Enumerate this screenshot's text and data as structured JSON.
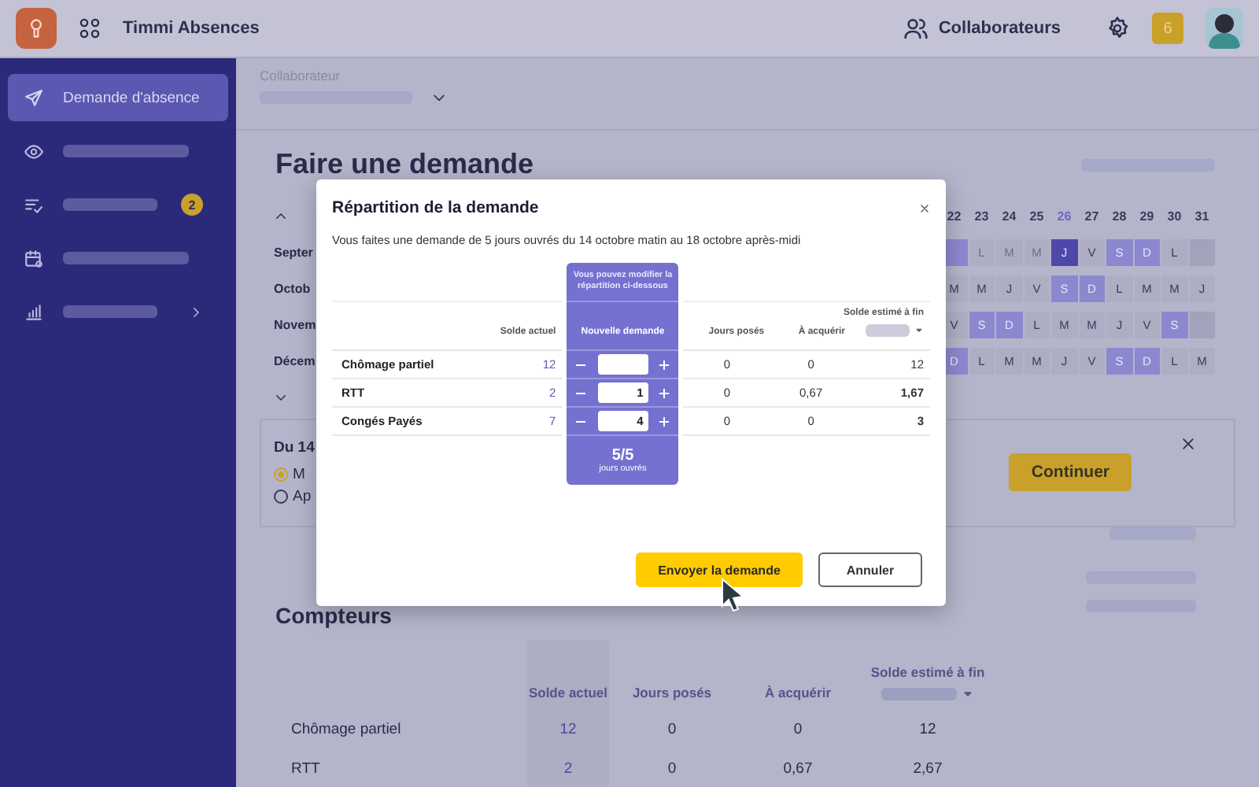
{
  "topbar": {
    "app_name": "Timmi Absences",
    "nav_link": "Collaborateurs",
    "notification_count": "6"
  },
  "sidebar": {
    "items": [
      {
        "label": "Demande d'absence",
        "selected": true,
        "expandable": false
      },
      {
        "selected": false,
        "expandable": false
      },
      {
        "selected": false,
        "expandable": false,
        "badge": "2"
      },
      {
        "selected": false,
        "expandable": false
      },
      {
        "selected": false,
        "expandable": true
      }
    ]
  },
  "employee_picker": {
    "label": "Collaborateur"
  },
  "page_title": "Faire une demande",
  "calendar": {
    "day_numbers": [
      {
        "label": "22",
        "today": false
      },
      {
        "label": "23",
        "today": false
      },
      {
        "label": "24",
        "today": false
      },
      {
        "label": "25",
        "today": false
      },
      {
        "label": "26",
        "today": true
      },
      {
        "label": "27",
        "today": false
      },
      {
        "label": "28",
        "today": false
      },
      {
        "label": "29",
        "today": false
      },
      {
        "label": "30",
        "today": false
      },
      {
        "label": "31",
        "today": false
      }
    ],
    "months": [
      {
        "label": "Septer",
        "days": [
          {
            "kind": "weekend"
          },
          {
            "kind": "past",
            "label": "L"
          },
          {
            "kind": "past",
            "label": "M"
          },
          {
            "kind": "past",
            "label": "M"
          },
          {
            "kind": "selected",
            "label": "J"
          },
          {
            "kind": "day",
            "label": "V"
          },
          {
            "kind": "weekend",
            "label": "S"
          },
          {
            "kind": "weekend",
            "label": "D"
          },
          {
            "kind": "day",
            "label": "L"
          },
          {
            "kind": "none"
          }
        ]
      },
      {
        "label": "Octob",
        "days": [
          {
            "kind": "day",
            "label": "M"
          },
          {
            "kind": "day",
            "label": "M"
          },
          {
            "kind": "day",
            "label": "J"
          },
          {
            "kind": "day",
            "label": "V"
          },
          {
            "kind": "weekend",
            "label": "S"
          },
          {
            "kind": "weekend",
            "label": "D"
          },
          {
            "kind": "day",
            "label": "L"
          },
          {
            "kind": "day",
            "label": "M"
          },
          {
            "kind": "day",
            "label": "M"
          },
          {
            "kind": "day",
            "label": "J"
          }
        ]
      },
      {
        "label": "Novem",
        "days": [
          {
            "kind": "day",
            "label": "V"
          },
          {
            "kind": "weekend",
            "label": "S"
          },
          {
            "kind": "weekend",
            "label": "D"
          },
          {
            "kind": "day",
            "label": "L"
          },
          {
            "kind": "day",
            "label": "M"
          },
          {
            "kind": "day",
            "label": "M"
          },
          {
            "kind": "day",
            "label": "J"
          },
          {
            "kind": "day",
            "label": "V"
          },
          {
            "kind": "weekend",
            "label": "S"
          },
          {
            "kind": "none"
          }
        ]
      },
      {
        "label": "Décem",
        "days": [
          {
            "kind": "weekend",
            "label": "D"
          },
          {
            "kind": "day",
            "label": "L"
          },
          {
            "kind": "day",
            "label": "M"
          },
          {
            "kind": "day",
            "label": "M"
          },
          {
            "kind": "day",
            "label": "J"
          },
          {
            "kind": "day",
            "label": "V"
          },
          {
            "kind": "weekend",
            "label": "S"
          },
          {
            "kind": "weekend",
            "label": "D"
          },
          {
            "kind": "day",
            "label": "L"
          },
          {
            "kind": "day",
            "label": "M"
          }
        ]
      }
    ]
  },
  "request_card": {
    "title": "Du 14",
    "options": [
      {
        "label": "M",
        "selected": true
      },
      {
        "label": "Ap",
        "selected": false
      }
    ],
    "continue_button": "Continuer"
  },
  "counters": {
    "title": "Compteurs",
    "columns": [
      "Solde actuel",
      "Jours posés",
      "À acquérir",
      "Solde estimé à fin"
    ],
    "rows": [
      {
        "label": "Chômage partiel",
        "balance": "12",
        "taken": "0",
        "to_acquire": "0",
        "estimated": "12"
      },
      {
        "label": "RTT",
        "balance": "2",
        "taken": "0",
        "to_acquire": "0,67",
        "estimated": "2,67"
      }
    ]
  },
  "dialog": {
    "title": "Répartition de la demande",
    "message": "Vous faites une demande de 5 jours ouvrés du 14 octobre matin au 18 octobre après-midi",
    "hint": "Vous pouvez modifier la répartition ci-dessous",
    "columns": [
      "Solde actuel",
      "Nouvelle demande",
      "Jours posés",
      "À acquérir",
      "Solde estimé à fin"
    ],
    "rows": [
      {
        "label": "Chômage partiel",
        "balance": "12",
        "taken": "0",
        "to_acquire": "0",
        "estimated": "12",
        "emphasized": false
      },
      {
        "label": "RTT",
        "balance": "2",
        "value": "1",
        "taken": "0",
        "to_acquire": "0,67",
        "estimated": "1,67",
        "emphasized": true
      },
      {
        "label": "Congés Payés",
        "balance": "7",
        "value": "4",
        "taken": "0",
        "to_acquire": "0",
        "estimated": "3",
        "emphasized": true
      }
    ],
    "total": "5/5",
    "total_unit": "jours ouvrés",
    "buttons": [
      {
        "label": "Envoyer la demande",
        "kind": "primary"
      },
      {
        "label": "Annuler",
        "kind": "secondary"
      }
    ]
  }
}
